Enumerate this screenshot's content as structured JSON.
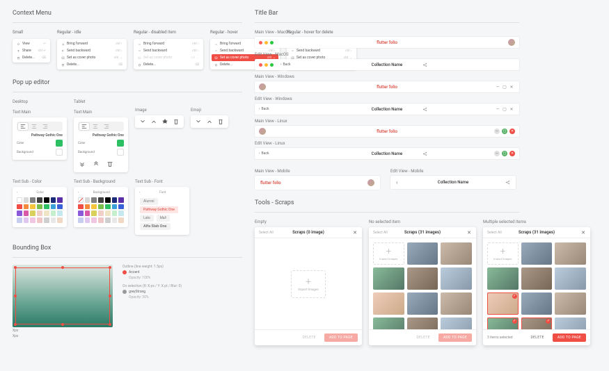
{
  "sections": {
    "context": "Context Menu",
    "titlebar": "Title Bar",
    "popup": "Pop up editor",
    "bb": "Bounding Box",
    "tools": "Tools - Scraps"
  },
  "ctx": {
    "small": "Small",
    "regIdle": "Regular - idle",
    "regDisabled": "Regular - disabled item",
    "regHover": "Regular - hover",
    "regHoverDel": "Regular - hover for delete",
    "items": {
      "view": "View",
      "share": "Share",
      "delete": "Delete...",
      "bringFwd": "Bring forward",
      "sendBwd": "Send backward",
      "setCover": "Set as cover photo",
      "del": "Delete..."
    },
    "kbd": {
      "view": "↵",
      "share": "ctrl ↵",
      "del": "⌫",
      "fwd": "ctrl ↑",
      "bwd": "ctrl ↓",
      "cover": "ctrl →"
    }
  },
  "tb": {
    "mainMac": "Main View - MacOS",
    "editMac": "Edit View - MacOS",
    "mainWin": "Main View - Windows",
    "editWin": "Edit View - Windows",
    "mainLin": "Main View - Linux",
    "editLin": "Edit View - Linux",
    "mainMob": "Main View - Mobile",
    "editMob": "Edit View - Mobile",
    "flutter": "flutter folio",
    "collection": "Collection Name",
    "back": "Back"
  },
  "pop": {
    "desktop": "Desktop",
    "tablet": "Tablet",
    "txtMain": "Text Main",
    "image": "Image",
    "emoji": "Emoji",
    "font": "Pathway Gothic One",
    "color": "Color",
    "bg": "Background",
    "subColor": "Text Sub - Color",
    "subBg": "Text Sub - Background",
    "subFont": "Text Sub - Font",
    "fonts": {
      "f1": "Alumni",
      "f2": "Pathway Gothic One",
      "f3": "Lato",
      "f4": "Mali",
      "f5": "Alfa Slab One"
    }
  },
  "bb": {
    "dim1": "Xpx",
    "dim2": "Xpx",
    "outline": "Outline (line weight: 1.5px)",
    "onsel": "On selection (R: X.px / Y: X.pt / Blur: 0)",
    "accent": "Accent",
    "accentOp": "Opacity: 100%",
    "greyStrong": "greyStrong",
    "greyOp": "Opacity: 30%"
  },
  "scraps": {
    "empty": "Empty",
    "nosel": "No selected item",
    "multi": "Multiple selected items",
    "selectAll": "Select All",
    "import": "Import Images",
    "title0": "Scraps (0 image)",
    "title31": "Scraps (31 images)",
    "delete": "DELETE",
    "add": "ADD TO PAGE",
    "count": "3 items selected"
  },
  "colors": {
    "palette": [
      "#ffffff",
      "#d9d9d9",
      "#808080",
      "#404040",
      "#000000",
      "#1b2b7a",
      "#5b2fa8",
      "#f04e45",
      "#f58a3c",
      "#f5c63c",
      "#7abf4e",
      "#2dbf64",
      "#3aa0d8",
      "#3a62d8",
      "#8a5ad8",
      "#d85aa8",
      "#d8d05a",
      "#f0cfc6",
      "#f0e4c6",
      "#c6f0cd",
      "#c6e8f0",
      "#c6cdf0",
      "#e0c6f0",
      "#f0c6e0",
      "#f0c6c6",
      "#cfcfcf",
      "#e8e8e8",
      "#f0d8c6"
    ]
  }
}
